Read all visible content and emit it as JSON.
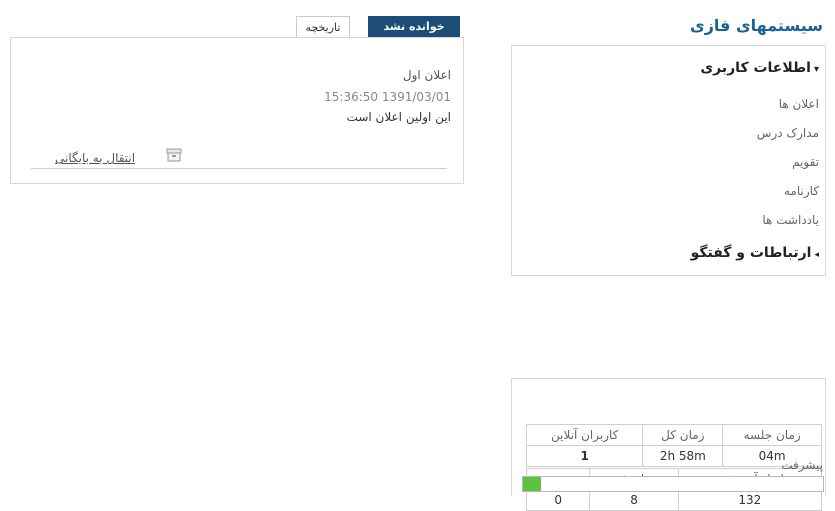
{
  "brand": {
    "title": "سیستمهای فازی"
  },
  "nav": {
    "section1": "اطلاعات کاربری",
    "items": [
      {
        "label": "اعلان ها"
      },
      {
        "label": "مدارک درس"
      },
      {
        "label": "تقویم"
      },
      {
        "label": "کارنامه"
      },
      {
        "label": "یادداشت ها"
      }
    ],
    "section2": "ارتباطات و گفتگو"
  },
  "stats": {
    "table1": {
      "headers": [
        "زمان جلسه",
        "زمان کل",
        "کاربران آنلاین"
      ],
      "values": [
        "04m",
        "2h 58m",
        "1"
      ]
    },
    "table2": {
      "headers": [
        "ابزار آموزشی",
        "تمام شد",
        "مردود"
      ],
      "values": [
        "132",
        "8",
        "0"
      ]
    },
    "progress_label": "پیشرفت",
    "progress_fraction": 0.06
  },
  "tabs": {
    "unread": "خوانده نشد",
    "history": "تاریخچه"
  },
  "announcement": {
    "title": "اعلان اول",
    "datetime": "15:36:50 1391/03/01",
    "text": "این اولین اعلان است",
    "archive_link": "انتقال به بایگانی"
  },
  "colors": {
    "brand": "#17639a",
    "tab_active": "#1c4d78",
    "progress": "#5cc23f"
  }
}
